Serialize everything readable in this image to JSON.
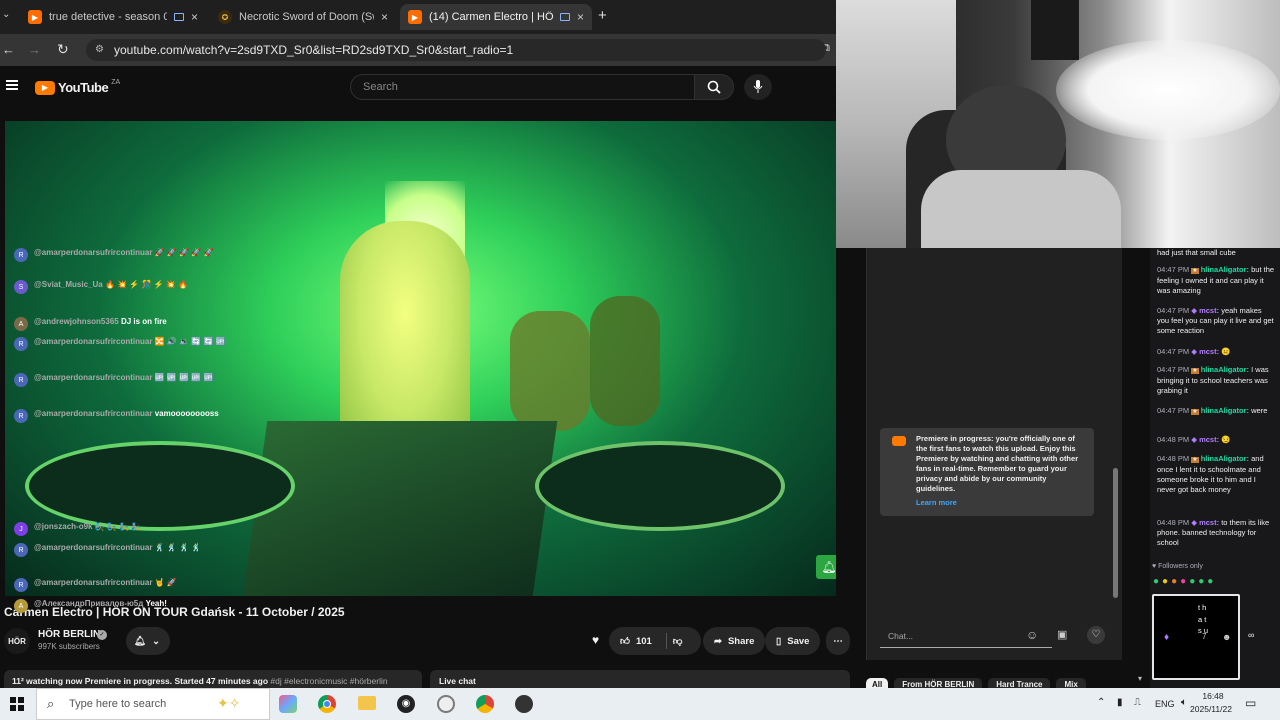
{
  "browser": {
    "tabs": [
      {
        "title": "true detective - season 01",
        "close": "×",
        "active": false
      },
      {
        "title": "Necrotic Sword of Doom (Swor",
        "close": "×",
        "active": false
      },
      {
        "title": "(14) Carmen Electro | HÖR",
        "close": "×",
        "active": true
      }
    ],
    "new_tab": "+",
    "url": "youtube.com/watch?v=2sd9TXD_Sr0&list=RD2sd9TXD_Sr0&start_radio=1"
  },
  "youtube": {
    "logo": "YouTube",
    "country": "ZA",
    "search_placeholder": "Search",
    "video_title": "Carmen Electro | HÖR ON TOUR Gdańsk - 11 October / 2025",
    "channel": {
      "name": "HÖR BERLIN",
      "avatar": "HÖR",
      "subs": "997K subscribers"
    },
    "likes": "101",
    "share": "Share",
    "save": "Save",
    "meta": {
      "watching": "11² watching now",
      "premiere": "Premiere in progress. Started 47 minutes ago",
      "tags": "#dj #electronicmusic #hörberlin"
    },
    "live_chat_label": "Live chat",
    "chips": [
      "All",
      "From HÖR BERLIN",
      "Hard Trance",
      "Mix"
    ],
    "chat": [
      {
        "author": "@amarperdonarsufrircontinuar",
        "msg": "🚀 🚀 🚀 🚀 🚀",
        "color": "#4b67b7"
      },
      {
        "author": "@Sviat_Music_Ua",
        "msg": "🔥 💥 ⚡ 🎊 ⚡ 💥 🔥",
        "color": "#6a5acd"
      },
      {
        "author": "@andrewjohnson5365",
        "msg": "DJ is on fire",
        "color": "#7a6a4a"
      },
      {
        "author": "@amarperdonarsufrircontinuar",
        "msg": "🔀 🔊 🔉 🔄 🔄 🆙",
        "color": "#4b67b7"
      },
      {
        "author": "@amarperdonarsufrircontinuar",
        "msg": "🆙 🆙 🆙 🆙 🆙",
        "color": "#4b67b7"
      },
      {
        "author": "@amarperdonarsufrircontinuar",
        "msg": "vamooooooooss",
        "color": "#4b67b7"
      },
      {
        "author": "@jonszach-o9k",
        "msg": "🧞 🧞 🧞 🧞",
        "color": "#7b3fe4"
      },
      {
        "author": "@amarperdonarsufrircontinuar",
        "msg": "🕺 🕺 🕺 🕺",
        "color": "#4b67b7"
      },
      {
        "author": "@amarperdonarsufrircontinuar",
        "msg": "🤘 🚀",
        "color": "#4b67b7"
      },
      {
        "author": "@АлександрПривалов-ю5д",
        "msg": "Yeah!",
        "color": "#b59a3a"
      }
    ],
    "premiere_notice": "Premiere in progress: you're officially one of the first fans to watch this upload. Enjoy this Premiere by watching and chatting with other fans in real-time. Remember to guard your privacy and abide by our community guidelines.",
    "learn_more": "Learn more",
    "chat_placeholder": "Chat..."
  },
  "twitch": {
    "lines": [
      {
        "time": "",
        "name": "",
        "text": "had just that small cube"
      },
      {
        "time": "04:47 PM",
        "name": "hlinaAligator:",
        "text": "but the feeling I owned it and can play it was amazing",
        "color": "#1fd8a0"
      },
      {
        "time": "04:47 PM",
        "name": "mcst:",
        "text": "yeah makes you feel you can play it live and get some reaction",
        "color": "#b07cff"
      },
      {
        "time": "04:47 PM",
        "name": "mcst:",
        "text": "😐",
        "color": "#b07cff"
      },
      {
        "time": "04:47 PM",
        "name": "hlinaAligator:",
        "text": "I was bringing it to school teachers was grabing it",
        "color": "#1fd8a0"
      },
      {
        "time": "04:47 PM",
        "name": "hlinaAligator:",
        "text": "were",
        "color": "#1fd8a0"
      },
      {
        "time": "04:48 PM",
        "name": "mcst:",
        "text": "😏",
        "color": "#b07cff"
      },
      {
        "time": "04:48 PM",
        "name": "hlinaAligator:",
        "text": "and once I lent it to schoolmate and someone broke it to him and I never got back money",
        "color": "#1fd8a0"
      },
      {
        "time": "04:48 PM",
        "name": "mcst:",
        "text": "to them its like phone. banned technology for school",
        "color": "#b07cff"
      }
    ],
    "followers_only": "Followers only",
    "typing": "t h a t s u"
  },
  "taskbar": {
    "search_placeholder": "Type here to search",
    "lang": "ENG",
    "time": "16:48",
    "date": "2025/11/22"
  }
}
